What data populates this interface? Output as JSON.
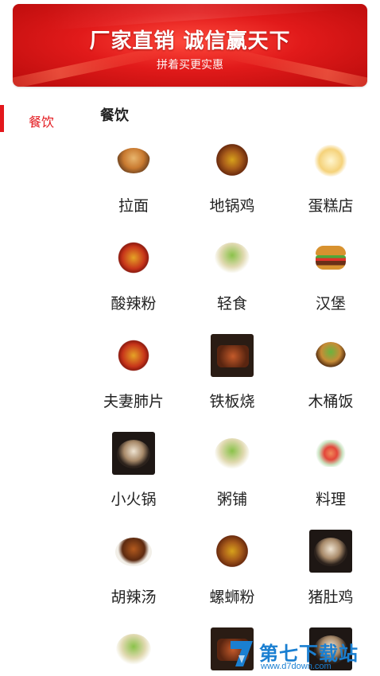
{
  "banner": {
    "title": "厂家直销  诚信赢天下",
    "subtitle": "拼着买更实惠"
  },
  "sidebar": {
    "items": [
      {
        "label": "餐饮",
        "active": true
      }
    ]
  },
  "section": {
    "title": "餐饮"
  },
  "categories": [
    {
      "label": "拉面",
      "icon": "ramen-icon"
    },
    {
      "label": "地锅鸡",
      "icon": "pot-chicken-icon"
    },
    {
      "label": "蛋糕店",
      "icon": "cake-icon"
    },
    {
      "label": "酸辣粉",
      "icon": "hot-sour-noodles-icon"
    },
    {
      "label": "轻食",
      "icon": "salad-icon"
    },
    {
      "label": "汉堡",
      "icon": "burger-icon"
    },
    {
      "label": "夫妻肺片",
      "icon": "sliced-beef-icon"
    },
    {
      "label": "铁板烧",
      "icon": "teppanyaki-icon"
    },
    {
      "label": "木桶饭",
      "icon": "bucket-rice-icon"
    },
    {
      "label": "小火锅",
      "icon": "hotpot-icon"
    },
    {
      "label": "粥铺",
      "icon": "porridge-icon"
    },
    {
      "label": "料理",
      "icon": "cuisine-icon"
    },
    {
      "label": "胡辣汤",
      "icon": "spicy-soup-icon"
    },
    {
      "label": "螺蛳粉",
      "icon": "snail-noodles-icon"
    },
    {
      "label": "猪肚鸡",
      "icon": "pork-tripe-chicken-icon"
    },
    {
      "label": "",
      "icon": "soup-bowl-icon"
    },
    {
      "label": "",
      "icon": "grilled-dish-icon"
    },
    {
      "label": "",
      "icon": "dark-dish-icon"
    }
  ],
  "watermark": {
    "text": "第七下载站",
    "url": "www.d7down.com"
  },
  "colors": {
    "accent": "#e3171c",
    "banner": "#e11a1a",
    "watermark": "#1a7fd1"
  }
}
